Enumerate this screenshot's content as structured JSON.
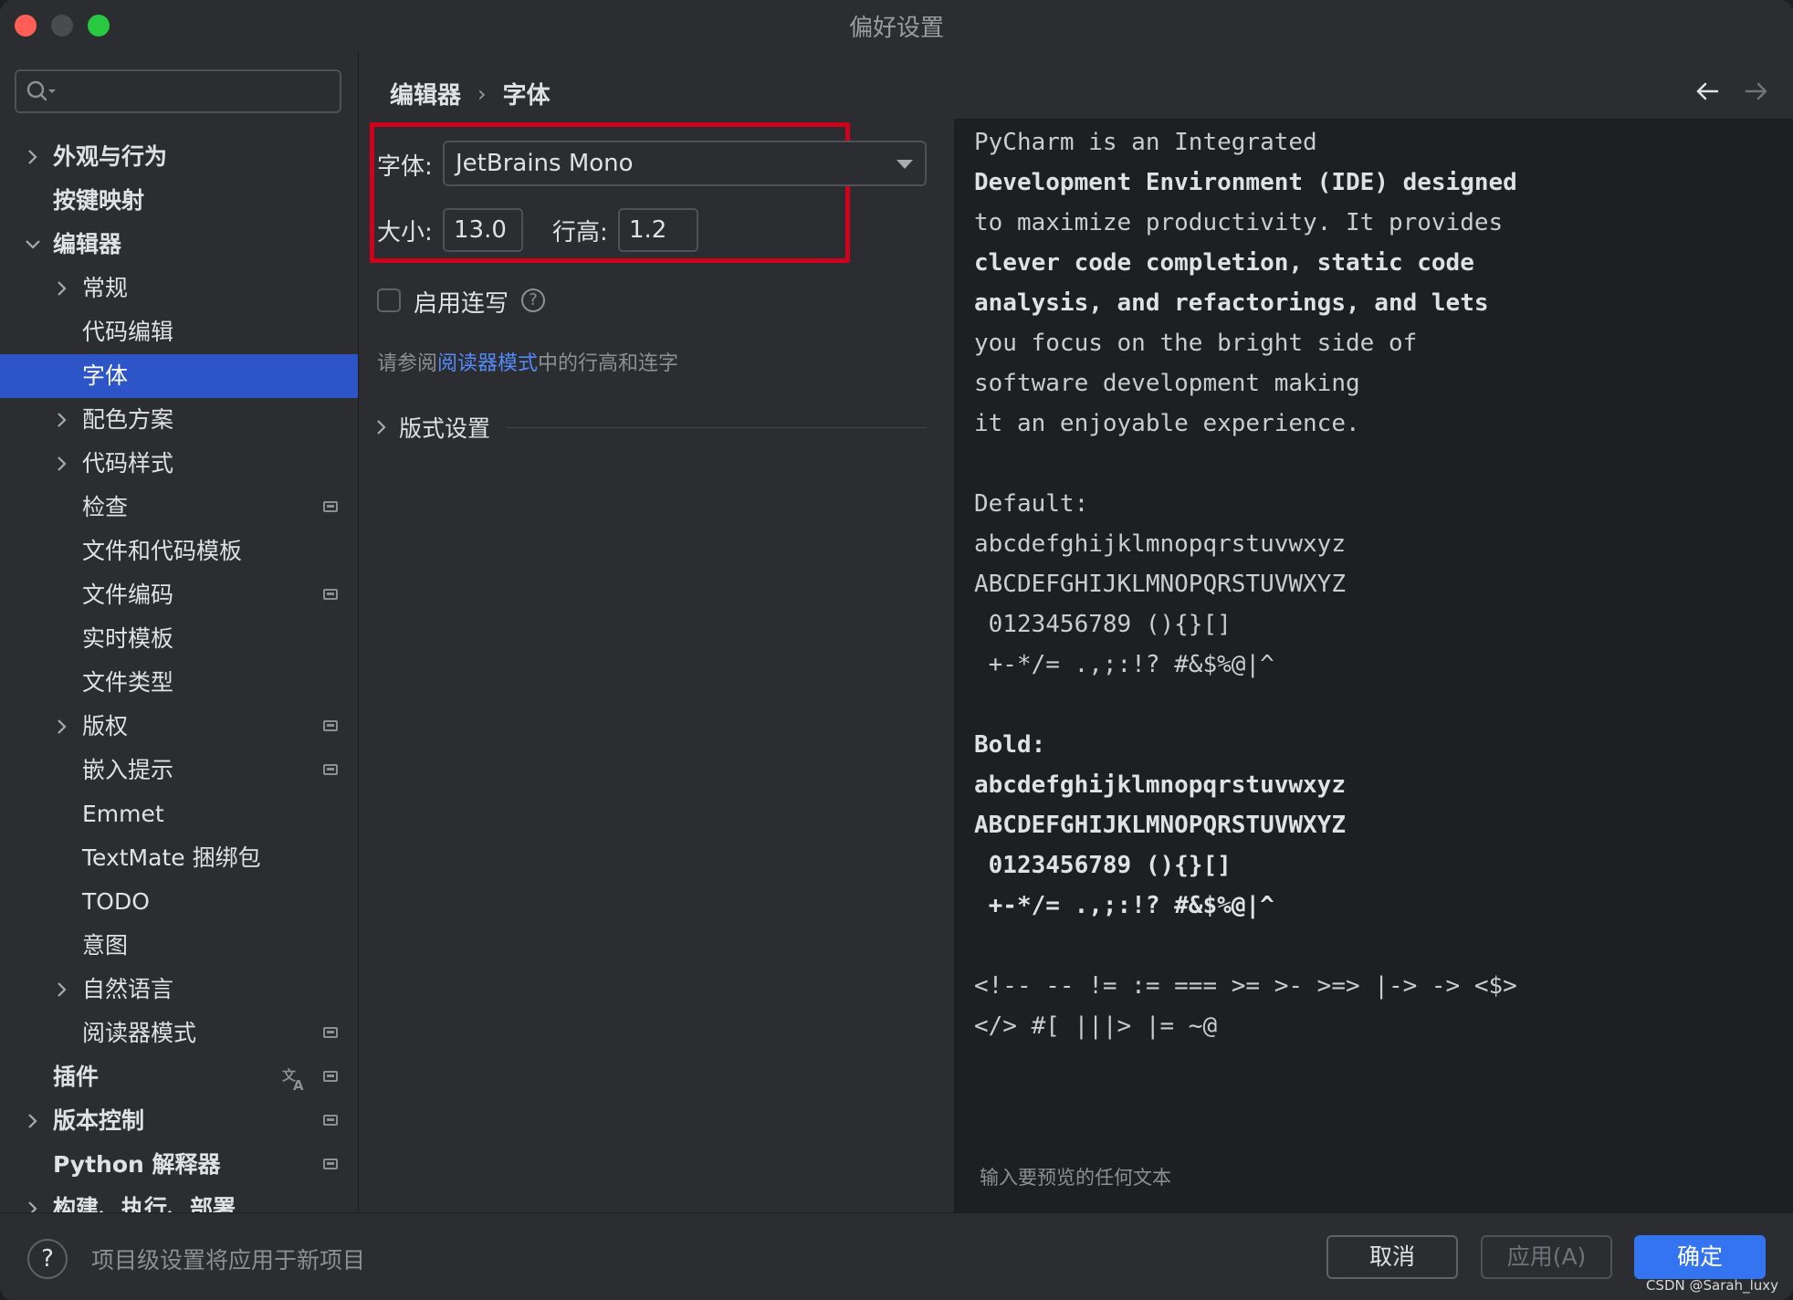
{
  "window": {
    "title": "偏好设置"
  },
  "sidebar": {
    "search_placeholder": "",
    "items": [
      {
        "label": "外观与行为"
      },
      {
        "label": "按键映射"
      },
      {
        "label": "编辑器"
      },
      {
        "label": "常规"
      },
      {
        "label": "代码编辑"
      },
      {
        "label": "字体"
      },
      {
        "label": "配色方案"
      },
      {
        "label": "代码样式"
      },
      {
        "label": "检查"
      },
      {
        "label": "文件和代码模板"
      },
      {
        "label": "文件编码"
      },
      {
        "label": "实时模板"
      },
      {
        "label": "文件类型"
      },
      {
        "label": "版权"
      },
      {
        "label": "嵌入提示"
      },
      {
        "label": "Emmet"
      },
      {
        "label": "TextMate 捆绑包"
      },
      {
        "label": "TODO"
      },
      {
        "label": "意图"
      },
      {
        "label": "自然语言"
      },
      {
        "label": "阅读器模式"
      },
      {
        "label": "插件"
      },
      {
        "label": "版本控制"
      },
      {
        "label": "Python 解释器"
      },
      {
        "label": "构建、执行、部署"
      }
    ]
  },
  "breadcrumb": {
    "parent": "编辑器",
    "separator": "›",
    "current": "字体"
  },
  "font_settings": {
    "font_label": "字体:",
    "font_value": "JetBrains Mono",
    "size_label": "大小:",
    "size_value": "13.0",
    "line_height_label": "行高:",
    "line_height_value": "1.2",
    "ligatures_label": "启用连写",
    "ligatures_checked": false,
    "hint_prefix": "请参阅",
    "hint_link": "阅读器模式",
    "hint_suffix": "中的行高和连字",
    "typography_label": "版式设置"
  },
  "preview": {
    "lines": [
      "PyCharm is an Integrated",
      "Development Environment (IDE) designed",
      "to maximize productivity. It provides",
      "clever code completion, static code",
      "analysis, and refactorings, and lets",
      "you focus on the bright side of",
      "software development making",
      "it an enjoyable experience.",
      "",
      "Default:",
      "abcdefghijklmnopqrstuvwxyz",
      "ABCDEFGHIJKLMNOPQRSTUVWXYZ",
      " 0123456789 (){}[]",
      " +-*/= .,;:!? #&$%@|^",
      "",
      "Bold:",
      "abcdefghijklmnopqrstuvwxyz",
      "ABCDEFGHIJKLMNOPQRSTUVWXYZ",
      " 0123456789 (){}[]",
      " +-*/= .,;:!? #&$%@|^",
      "",
      "<!-- -- != := === >= >- >=> |-> -> <$>",
      "</> #[ |||> |= ~@"
    ],
    "placeholder": "输入要预览的任何文本"
  },
  "footer": {
    "help": "?",
    "note": "项目级设置将应用于新项目",
    "cancel": "取消",
    "apply": "应用(A)",
    "ok": "确定"
  },
  "watermark": "CSDN @Sarah_luxy",
  "colors": {
    "accent": "#3574f0",
    "selection": "#2e55c7",
    "highlight_box": "#d0021b",
    "link": "#548af7"
  }
}
